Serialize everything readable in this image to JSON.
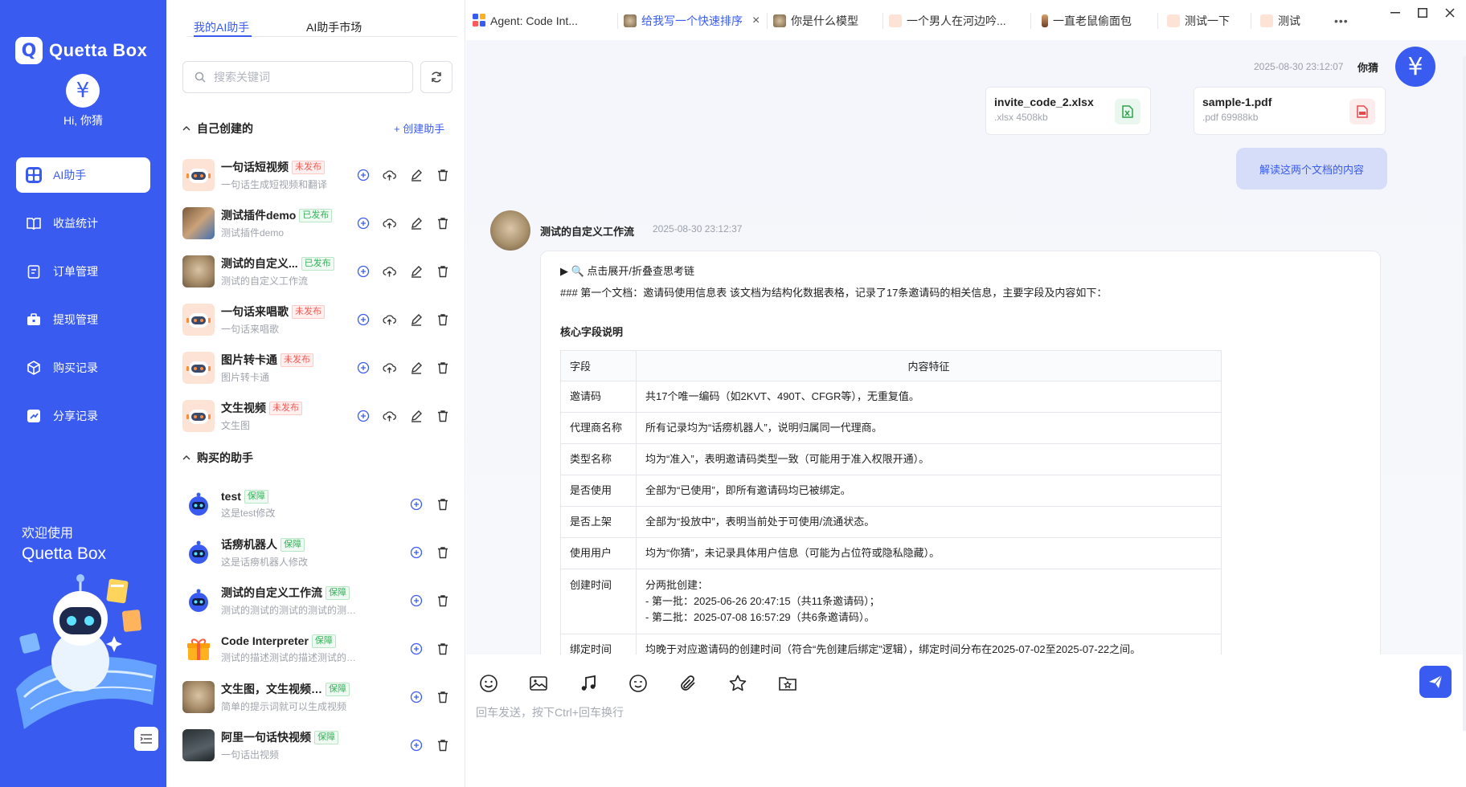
{
  "app": {
    "logo_glyph": "Q",
    "logo_text": "Quetta Box",
    "user_avatar_glyph": "¥",
    "greeting": "Hi, 你猜"
  },
  "colors": {
    "brand": "#3a5bf0",
    "tag_unpublished": "#f25c54",
    "tag_published": "#34b35a",
    "user_bubble": "#d5ddf9"
  },
  "nav": {
    "items": [
      {
        "label": "AI助手",
        "icon": "grid-icon",
        "active": true
      },
      {
        "label": "收益统计",
        "icon": "book-icon"
      },
      {
        "label": "订单管理",
        "icon": "clipboard-icon"
      },
      {
        "label": "提现管理",
        "icon": "briefcase-icon"
      },
      {
        "label": "购买记录",
        "icon": "cube-icon"
      },
      {
        "label": "分享记录",
        "icon": "share-icon"
      }
    ]
  },
  "welcome": {
    "line1": "欢迎使用",
    "line2": "Quetta Box"
  },
  "panel": {
    "tabs": [
      {
        "label": "我的AI助手",
        "active": true
      },
      {
        "label": "AI助手市场"
      }
    ],
    "search_placeholder": "搜索关键词",
    "section_mine": "自己创建的",
    "create_label": "+ 创建助手",
    "section_bought": "购买的助手",
    "mine": [
      {
        "name": "一句话短视频",
        "tag": "未发布",
        "tag_color": "red",
        "desc": "一句话生成短视频和翻译",
        "avatar": "robot"
      },
      {
        "name": "测试插件demo",
        "tag": "已发布",
        "tag_color": "green",
        "desc": "测试插件demo",
        "avatar": "photo1"
      },
      {
        "name": "测试的自定义...",
        "tag": "已发布",
        "tag_color": "green",
        "desc": "测试的自定义工作流",
        "avatar": "cat"
      },
      {
        "name": "一句话来唱歌",
        "tag": "未发布",
        "tag_color": "red",
        "desc": "一句话来唱歌",
        "avatar": "robot"
      },
      {
        "name": "图片转卡通",
        "tag": "未发布",
        "tag_color": "red",
        "desc": "图片转卡通",
        "avatar": "robot"
      },
      {
        "name": "文生视频",
        "tag": "未发布",
        "tag_color": "red",
        "desc": "文生图",
        "avatar": "robot"
      }
    ],
    "bought": [
      {
        "name": "test",
        "tag": "保障",
        "tag_color": "green",
        "desc": "这是test修改",
        "avatar": "blue"
      },
      {
        "name": "话痨机器人",
        "tag": "保障",
        "tag_color": "green",
        "desc": "这是话痨机器人修改",
        "avatar": "blue"
      },
      {
        "name": "测试的自定义工作流",
        "tag": "保障",
        "tag_color": "green",
        "desc": "测试的测试的测试的测试的测试的测...",
        "avatar": "blue"
      },
      {
        "name": "Code Interpreter",
        "tag": "保障",
        "tag_color": "green",
        "desc": "测试的描述测试的描述测试的描述测...",
        "avatar": "gift"
      },
      {
        "name": "文生图，文生视频，图生...",
        "tag": "保障",
        "tag_color": "green",
        "desc": "简单的提示词就可以生成视频",
        "avatar": "cat"
      },
      {
        "name": "阿里一句话快视频",
        "tag": "保障",
        "tag_color": "green",
        "desc": "一句话出视频",
        "avatar": "dark"
      }
    ]
  },
  "tabs": [
    {
      "label": "Agent: Code Int...",
      "icon": "grid-icon"
    },
    {
      "label": "给我写一个快速排序",
      "active": true,
      "close": "×"
    },
    {
      "label": "你是什么模型"
    },
    {
      "label": "一个男人在河边吟..."
    },
    {
      "label": "一直老鼠偷面包"
    },
    {
      "label": "测试一下"
    },
    {
      "label": "测试"
    }
  ],
  "more_tabs": "•••",
  "chat": {
    "user_time": "2025-08-30 23:12:07",
    "user_name": "你猜",
    "files": [
      {
        "name": "invite_code_2.xlsx",
        "meta": ".xlsx 4508kb",
        "icon": "excel-icon"
      },
      {
        "name": "sample-1.pdf",
        "meta": ".pdf 69988kb",
        "icon": "pdf-icon"
      }
    ],
    "user_message": "解读这两个文档的内容",
    "bot_name": "测试的自定义工作流",
    "bot_time": "2025-08-30 23:12:37",
    "toggle": "▶ 🔍 点击展开/折叠查思考链",
    "intro": "### 第一个文档：邀请码使用信息表 该文档为结构化数据表格，记录了17条邀请码的相关信息，主要字段及内容如下：",
    "subheading": "核心字段说明",
    "table": {
      "headers": [
        "字段",
        "内容特征"
      ],
      "rows": [
        [
          "邀请码",
          "共17个唯一编码（如2KVT、490T、CFGR等），无重复值。"
        ],
        [
          "代理商名称",
          "所有记录均为“话痨机器人”，说明归属同一代理商。"
        ],
        [
          "类型名称",
          "均为“准入”，表明邀请码类型一致（可能用于准入权限开通）。"
        ],
        [
          "是否使用",
          "全部为“已使用”，即所有邀请码均已被绑定。"
        ],
        [
          "是否上架",
          "全部为“投放中”，表明当前处于可使用/流通状态。"
        ],
        [
          "使用用户",
          "均为“你猜”，未记录具体用户信息（可能为占位符或隐私隐藏）。"
        ],
        [
          "创建时间",
          "分两批创建：\n- 第一批：2025-06-26 20:47:15（共11条邀请码）；\n- 第二批：2025-07-08 16:57:29（共6条邀请码）。"
        ],
        [
          "绑定时间",
          "均晚于对应邀请码的创建时间（符合“先创建后绑定”逻辑），绑定时间分布在2025-07-02至2025-07-22之间。"
        ]
      ]
    },
    "composer_placeholder": "回车发送，按下Ctrl+回车换行",
    "tools": [
      "smile-icon",
      "image-icon",
      "music-icon",
      "sticker-icon",
      "paperclip-icon",
      "star-icon",
      "folder-star-icon"
    ]
  }
}
